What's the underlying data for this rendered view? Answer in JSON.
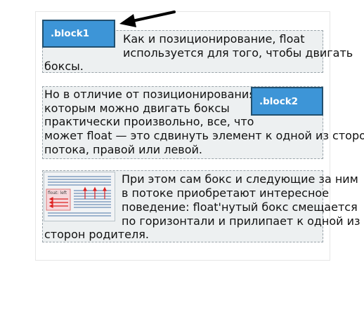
{
  "block1": {
    "label": ".block1"
  },
  "block2": {
    "label": ".block2"
  },
  "section1": {
    "lines": [
      "Как и позиционирование, float",
      "используется для того, чтобы двигать",
      "боксы."
    ]
  },
  "section2": {
    "lines": [
      "Но в отличие от позиционирования,",
      "которым можно двигать боксы",
      "практически произвольно, все, что",
      "может float — это сдвинуть элемент к одной из сторон",
      "потока, правой или левой."
    ]
  },
  "section3": {
    "thumbnail": {
      "label": "float: left"
    },
    "lines": [
      "При этом сам бокс и следующие за ним",
      "в потоке приобретают интересное",
      "поведение: float'нутый бокс смещается",
      "по горизонтали и прилипает к одной из",
      "сторон родителя."
    ]
  },
  "colors": {
    "block_fill": "#3d95d7",
    "block_border": "#22506f",
    "section_bg": "#edf0f1",
    "section_border": "#9aa4aa",
    "arrow": "#000000"
  }
}
